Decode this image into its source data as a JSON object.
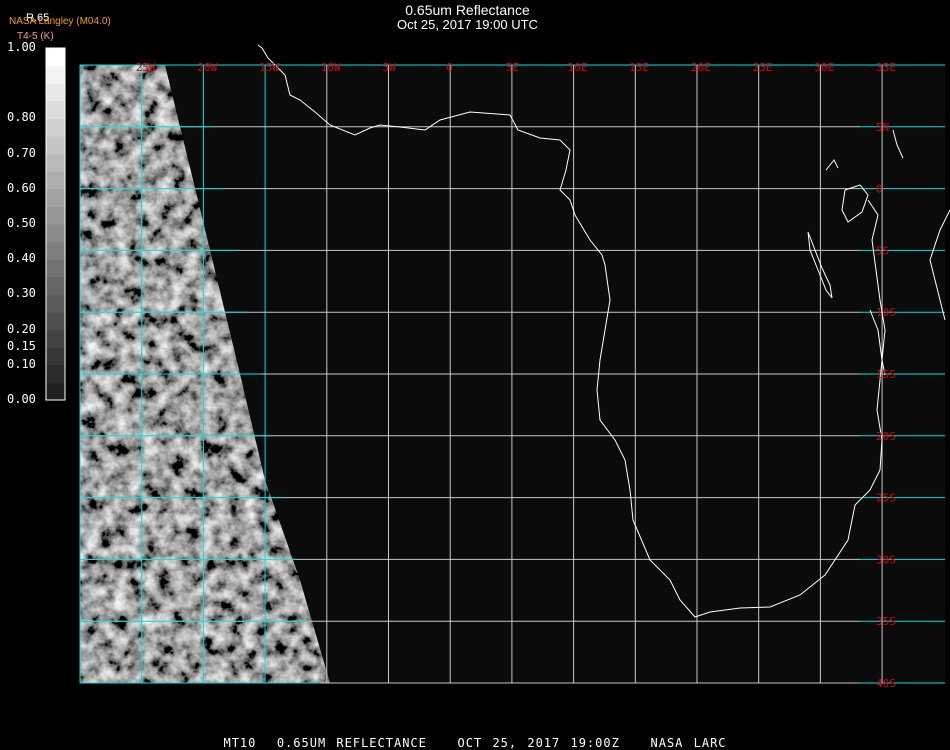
{
  "title": "0.65um Reflectance",
  "subtitle": "Oct 25, 2017 19:00 UTC",
  "provider": "NASA Langley (M04.0)",
  "colorbar": {
    "name": "R.65",
    "unit": "T4-5 (K)",
    "labels": [
      "1.00",
      "0.80",
      "0.70",
      "0.60",
      "0.50",
      "0.40",
      "0.30",
      "0.20",
      "0.15",
      "0.10",
      "0.00"
    ],
    "values": [
      1.0,
      0.8,
      0.7,
      0.6,
      0.5,
      0.4,
      0.3,
      0.2,
      0.15,
      0.1,
      0.0
    ]
  },
  "lon_labels": [
    "25W",
    "20W",
    "15W",
    "10W",
    "5W",
    "0",
    "5E",
    "10E",
    "15E",
    "20E",
    "25E",
    "30E",
    "35E"
  ],
  "lat_labels": [
    "5N",
    "0",
    "5S",
    "10S",
    "15S",
    "20S",
    "25S",
    "30S",
    "35S",
    "40S"
  ],
  "footer": "MT10  0.65UM REFLECTANCE   OCT 25, 2017 19:00Z   NASA LARC",
  "colors": {
    "grid_cyan": "#00e0e0",
    "grid_white": "#c8c8c8",
    "label_red": "#e00000",
    "coast": "#ffffff"
  }
}
